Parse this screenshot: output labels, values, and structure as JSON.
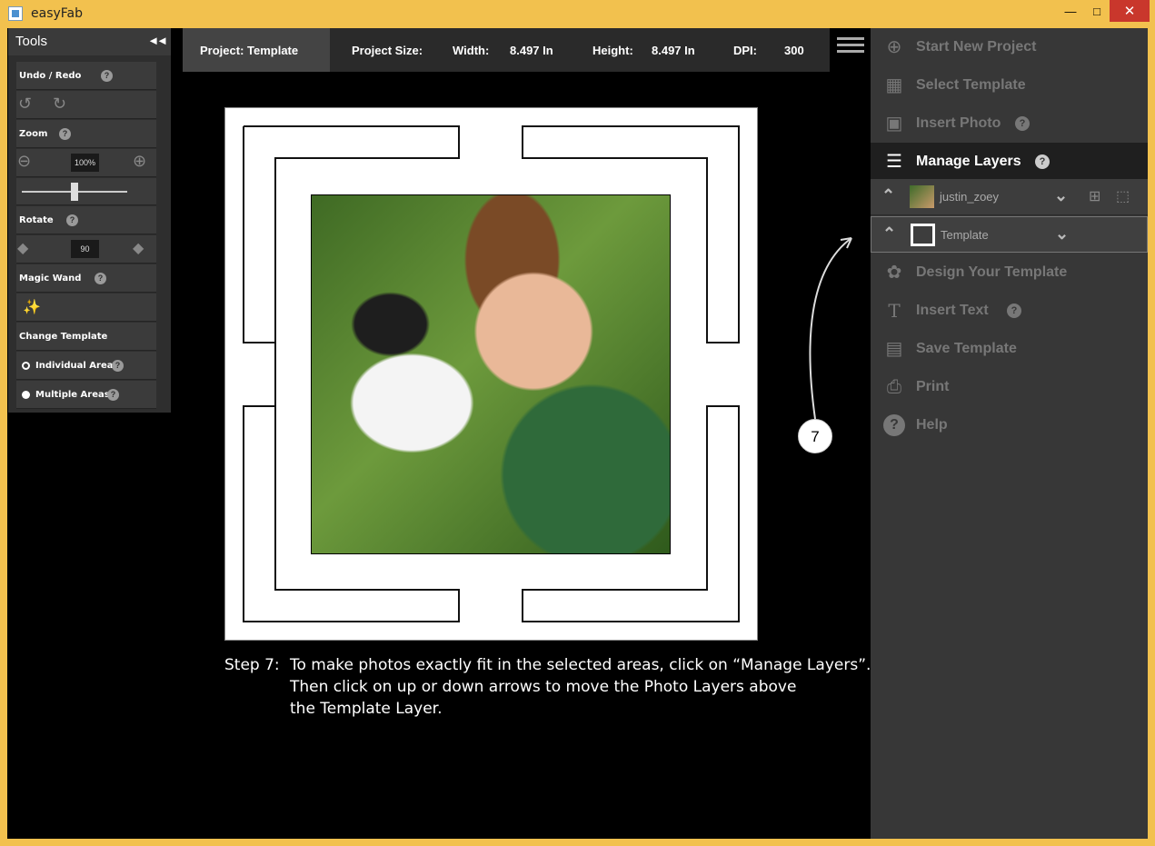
{
  "window": {
    "title": "easyFab",
    "min": "—",
    "max": "□",
    "close": "✕"
  },
  "tools": {
    "title": "Tools",
    "collapse": "◄◄",
    "undo_redo": "Undo / Redo",
    "zoom": "Zoom",
    "zoom_value": "100%",
    "zoom_slider": 0.5,
    "rotate": "Rotate",
    "rotate_value": "90",
    "magic_wand": "Magic Wand",
    "change_template": "Change Template",
    "individual_area": "Individual Area",
    "multiple_areas": "Multiple Areas",
    "help": "?"
  },
  "info": {
    "project": "Project: Template",
    "size_label": "Project Size:",
    "width_label": "Width:",
    "width_value": "8.497 In",
    "height_label": "Height:",
    "height_value": "8.497 In",
    "dpi_label": "DPI:",
    "dpi_value": "300"
  },
  "step": {
    "label": "Step 7:",
    "line1": "To make photos exactly fit in the selected areas, click on “Manage Layers”.",
    "line2": "Then click on up or down arrows to move the Photo Layers above",
    "line3": "the Template Layer."
  },
  "badge": "7",
  "menu": {
    "start_new_project": "Start New Project",
    "select_template": "Select Template",
    "insert_photo": "Insert Photo",
    "manage_layers": "Manage Layers",
    "design_template": "Design Your Template",
    "insert_text": "Insert Text",
    "save_template": "Save Template",
    "print": "Print",
    "help": "Help",
    "q": "?"
  },
  "layers": [
    {
      "name": "justin_zoey"
    },
    {
      "name": "Template"
    }
  ]
}
